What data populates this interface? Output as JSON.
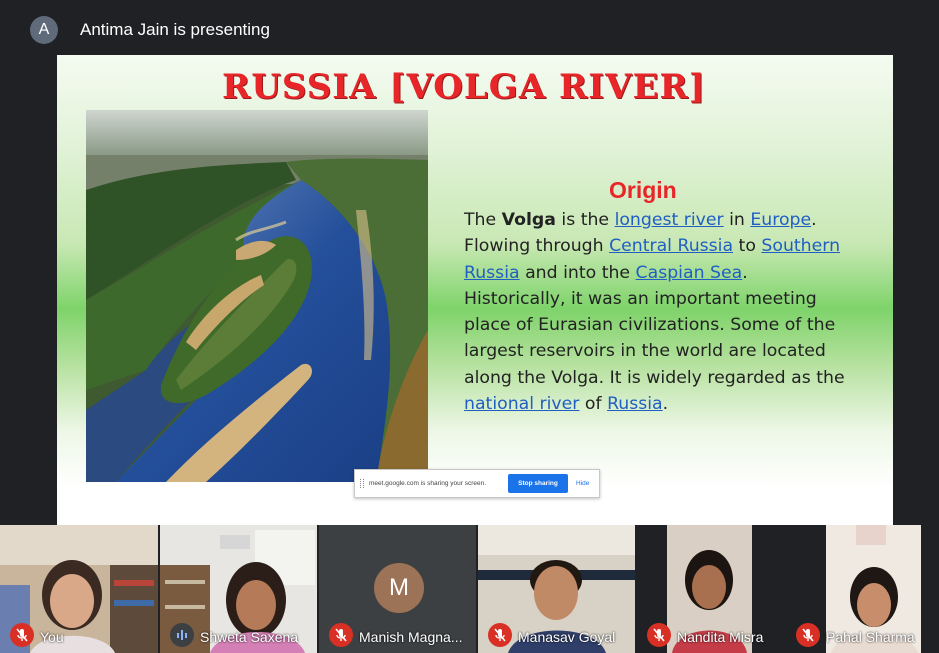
{
  "header": {
    "avatar_letter": "A",
    "presenting_text": "Antima Jain is presenting"
  },
  "slide": {
    "title": "RUSSIA [VOLGA RIVER]",
    "heading": "Origin",
    "text": {
      "p1": "The ",
      "volga": "Volga",
      "p2": " is the ",
      "link_longest_river": "longest river",
      "p3": " in ",
      "link_europe": "Europe",
      "p4": ". Flowing through ",
      "link_central_russia": "Central Russia",
      "p5": " to ",
      "link_southern_russia": "Southern Russia",
      "p6": " and into the ",
      "link_caspian_sea": "Caspian Sea",
      "p7": ". Historically, it was an important meeting place of Eurasian civilizations. Some of the largest reservoirs in the world are located along the Volga. It is widely regarded as the ",
      "link_national_river": "national river",
      "p8": " of ",
      "link_russia": "Russia",
      "p9": "."
    }
  },
  "share_bar": {
    "message": "meet.google.com is sharing your screen.",
    "stop_label": "Stop sharing",
    "hide_label": "Hide"
  },
  "participants": [
    {
      "name": "You",
      "mic": "muted"
    },
    {
      "name": "Shweta Saxena",
      "mic": "speaking"
    },
    {
      "name": "Manish Magna...",
      "mic": "muted",
      "avatar_letter": "M"
    },
    {
      "name": "Manasav Goyal",
      "mic": "muted"
    },
    {
      "name": "Nandita Misra",
      "mic": "muted"
    },
    {
      "name": "Pahal Sharma",
      "mic": "muted"
    }
  ],
  "colors": {
    "background": "#202124",
    "title_red": "#e8262a",
    "link_blue": "#1f5fc4",
    "mute_red": "#d93025",
    "meet_blue": "#1a73e8"
  },
  "icons": [
    "mic-off-icon",
    "audio-level-icon",
    "drag-handle-icon",
    "cursor-icon"
  ]
}
